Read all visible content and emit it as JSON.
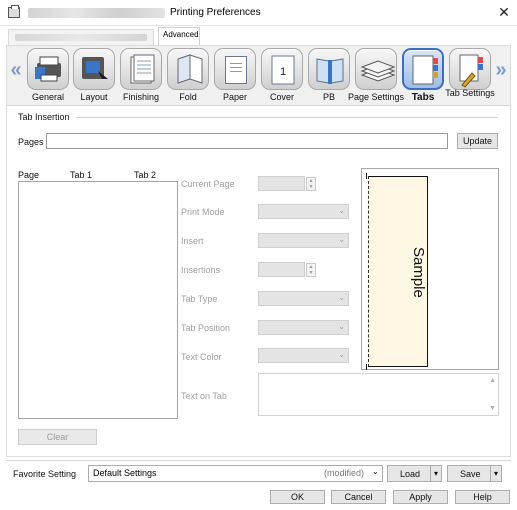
{
  "window": {
    "title": "Printing Preferences",
    "close_glyph": "✕"
  },
  "top_tabs": {
    "active_label": "Advanced"
  },
  "ribbon": {
    "left_arrow": "«",
    "right_arrow": "»",
    "items": [
      {
        "label": "General",
        "icon": "general-icon"
      },
      {
        "label": "Layout",
        "icon": "layout-icon"
      },
      {
        "label": "Finishing",
        "icon": "finishing-icon"
      },
      {
        "label": "Fold",
        "icon": "fold-icon"
      },
      {
        "label": "Paper",
        "icon": "paper-icon"
      },
      {
        "label": "Cover",
        "icon": "cover-icon",
        "badge": "1"
      },
      {
        "label": "PB",
        "icon": "perfect-binding-icon"
      },
      {
        "label": "Page Settings",
        "icon": "page-settings-icon"
      },
      {
        "label": "Tabs",
        "icon": "tabs-icon",
        "selected": true
      },
      {
        "label": "Tab Settings",
        "icon": "tab-settings-icon"
      }
    ]
  },
  "tab_insertion": {
    "group_label": "Tab Insertion",
    "pages_label": "Pages",
    "pages_value": "",
    "update_label": "Update",
    "list_headers": [
      "Page",
      "Tab 1",
      "Tab 2"
    ],
    "clear_label": "Clear",
    "fields": {
      "current_page": "Current Page",
      "print_mode": "Print Mode",
      "insert": "Insert",
      "insertions": "Insertions",
      "tab_type": "Tab Type",
      "tab_position": "Tab Position",
      "text_color": "Text Color",
      "text_on_tab": "Text on Tab"
    },
    "preview_text": "Sample"
  },
  "favorite": {
    "label": "Favorite Setting",
    "value": "Default Settings",
    "modified": "(modified)",
    "load_label": "Load",
    "save_label": "Save"
  },
  "dialog_buttons": {
    "ok": "OK",
    "cancel": "Cancel",
    "apply": "Apply",
    "help": "Help"
  },
  "colors": {
    "accent": "#3b6fbf",
    "arrow": "#7a9cc8",
    "preview_paper": "#fdf7e4"
  }
}
